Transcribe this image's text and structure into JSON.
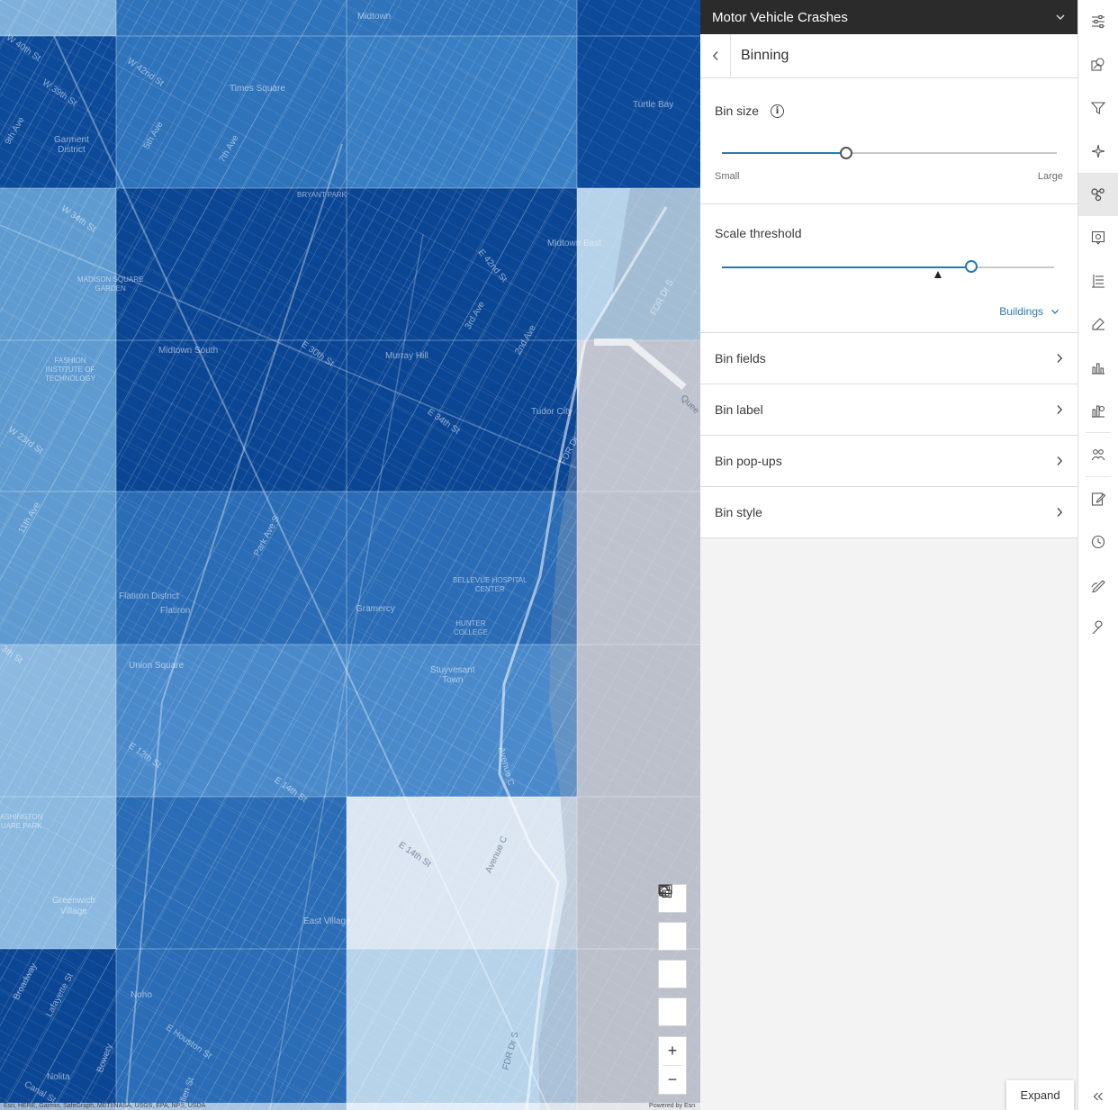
{
  "map": {
    "labels": {
      "midtown": "Midtown",
      "times_square": "Times Square",
      "turtle_bay": "Turtle Bay",
      "garment_district": "Garment\nDistrict",
      "bryant_park": "BRYANT PARK",
      "midtown_east": "Midtown East",
      "madison_square": "MADISON SQUARE\nGARDEN",
      "midtown_south": "Midtown South",
      "murray_hill": "Murray Hill",
      "fashion_institute": "FASHION\nINSTITUTE OF\nTECHNOLOGY",
      "tudor_city": "Tudor City",
      "flatiron": "Flatiron District",
      "flatiron2": "Flatiron",
      "gramercy": "Gramercy",
      "bellevue": "BELLEVUE HOSPITAL\nCENTER",
      "hunter": "HUNTER\nCOLLEGE",
      "union_square": "Union Square",
      "stuyvesant": "Stuyvesant\nTown",
      "washington_sq": "ASHINGTON\nUARE PARK",
      "greenwich": "Greenwich\nVillage",
      "east_village": "East Village",
      "noho": "Noho",
      "nolita": "Nolita",
      "w40": "W 40th St",
      "w42": "W 42nd St",
      "w39": "W 39th St",
      "w34": "W 34th St",
      "w23": "W 23rd St",
      "e42": "E 42nd St",
      "e34": "E 34th St",
      "e30": "E 30th St",
      "e12": "E 12th St",
      "e14": "E 14th St",
      "e14b": "E 14th St",
      "e_houston": "E Houston St",
      "fifth": "5th Ave",
      "seventh": "7th Ave",
      "ninth": "9th Ave",
      "eleventh": "11th Ave",
      "third": "3rd Ave",
      "second": "2nd Ave",
      "park": "Park Ave S",
      "fdr": "FDR Dr S",
      "fdr2": "FDR Dr",
      "fdr3": "FDR Dr S",
      "ave_c": "Avenue C",
      "ave_c2": "Avenue C",
      "broadway": "Broadway",
      "lafayette": "Lafayette St",
      "bowery": "Bowery",
      "allen": "Allen St",
      "queens": "Quee",
      "w13": "3th St",
      "canal": "Canal St"
    },
    "attribution_left": "Esri, HERE, Garmin, SafeGraph, METI/NASA, USGS, EPA, NPS, USDA",
    "attribution_right": "Powered by Esri",
    "tools": {
      "search": "search-icon",
      "basemap": "basemap-gallery-icon",
      "fullscreen": "fullscreen-icon",
      "home": "home-icon",
      "zoom_in": "+",
      "zoom_out": "−"
    }
  },
  "panel": {
    "layer_title": "Motor Vehicle Crashes",
    "title": "Binning",
    "bin_size": {
      "label": "Bin size",
      "min_label": "Small",
      "max_label": "Large",
      "value_fraction": 0.37
    },
    "scale_threshold": {
      "label": "Scale threshold",
      "value_fraction": 0.75,
      "marker_fraction": 0.65,
      "preset": "Buildings"
    },
    "rows": [
      {
        "label": "Bin fields"
      },
      {
        "label": "Bin label"
      },
      {
        "label": "Bin pop-ups"
      },
      {
        "label": "Bin style"
      }
    ]
  },
  "rail": {
    "active_index": 4,
    "tooltip": "Expand",
    "icons": [
      "properties-icon",
      "styles-icon",
      "filter-icon",
      "effects-icon",
      "aggregation-icon",
      "popups-icon",
      "fields-icon",
      "labels-icon",
      "charts-icon",
      "configure-chart-icon",
      "forms-icon",
      "edit-icon",
      "time-icon",
      "sketch-icon",
      "tools-icon"
    ]
  }
}
